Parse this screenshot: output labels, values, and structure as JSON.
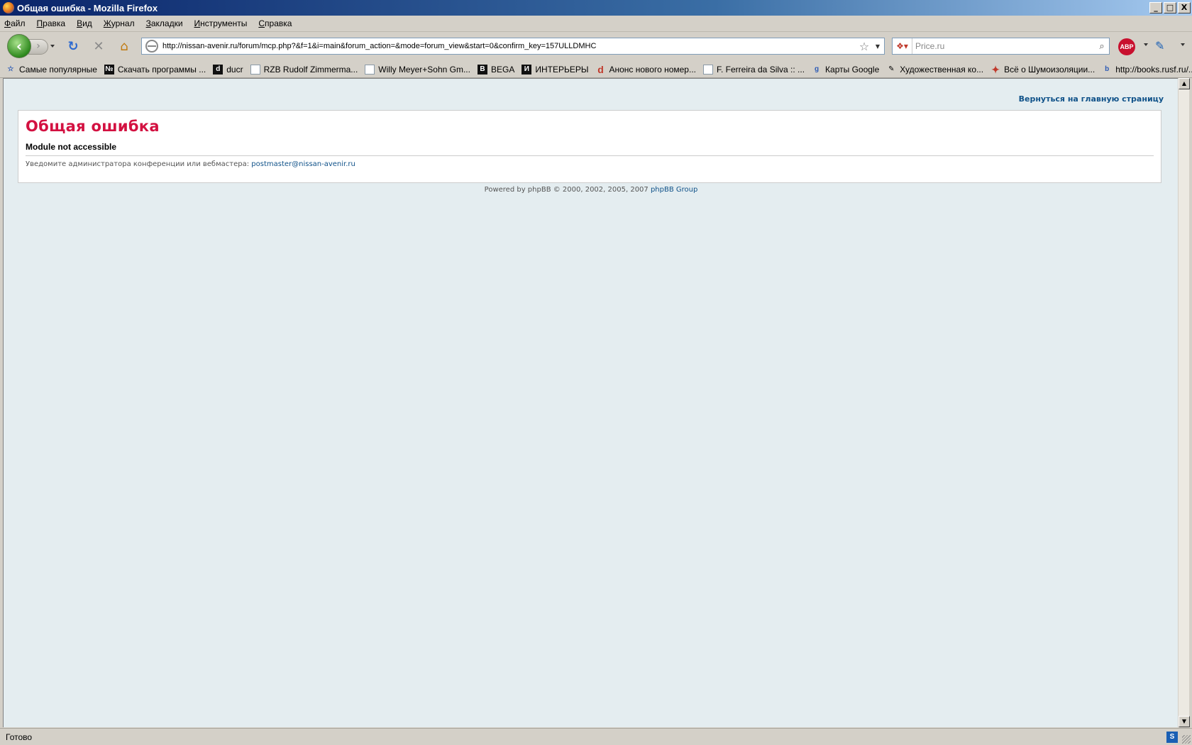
{
  "window": {
    "title": "Общая ошибка - Mozilla Firefox",
    "buttons": {
      "minimize": "_",
      "maximize": "□",
      "close": "X"
    }
  },
  "menu": {
    "items": [
      "Файл",
      "Правка",
      "Вид",
      "Журнал",
      "Закладки",
      "Инструменты",
      "Справка"
    ]
  },
  "nav": {
    "url": "http://nissan-avenir.ru/forum/mcp.php?&f=1&i=main&forum_action=&mode=forum_view&start=0&confirm_key=157ULLDMHC",
    "search_placeholder": "Price.ru",
    "abp_label": "ABP"
  },
  "bookmarks": [
    {
      "label": "Самые популярные",
      "icon": "star-folder-icon",
      "glyph": "☆"
    },
    {
      "label": "Скачать программы ...",
      "icon": "number-icon",
      "glyph": "№"
    },
    {
      "label": "ducr",
      "icon": "ducr-icon",
      "glyph": "d"
    },
    {
      "label": "RZB Rudolf Zimmerma...",
      "icon": "page-icon",
      "glyph": ""
    },
    {
      "label": "Willy Meyer+Sohn Gm...",
      "icon": "page-icon",
      "glyph": ""
    },
    {
      "label": "BEGA",
      "icon": "bega-icon",
      "glyph": "B"
    },
    {
      "label": "ИНТЕРЬЕРЫ",
      "icon": "interiors-icon",
      "glyph": "И"
    },
    {
      "label": "Анонс нового номер...",
      "icon": "d-icon",
      "glyph": "d"
    },
    {
      "label": "F. Ferreira da Silva :: ...",
      "icon": "page-icon",
      "glyph": ""
    },
    {
      "label": "Карты Google",
      "icon": "google-icon",
      "glyph": "g"
    },
    {
      "label": "Художественная ко...",
      "icon": "art-icon",
      "glyph": "✎"
    },
    {
      "label": "Всё о Шумоизоляции...",
      "icon": "mitsubishi-icon",
      "glyph": "✦"
    },
    {
      "label": "http://books.rusf.ru/...",
      "icon": "books-icon",
      "glyph": "b"
    }
  ],
  "page": {
    "back_link": "Вернуться на главную страницу",
    "error_title": "Общая ошибка",
    "error_message": "Module not accessible",
    "notice_text": "Уведомите администратора конференции или вебмастера: ",
    "notice_email": "postmaster@nissan-avenir.ru",
    "powered_text": "Powered by phpBB © 2000, 2002, 2005, 2007 ",
    "powered_link": "phpBB Group"
  },
  "status": {
    "text": "Готово"
  },
  "colors": {
    "page_bg": "#e4edf0",
    "error_title": "#d31141",
    "link": "#105289"
  }
}
